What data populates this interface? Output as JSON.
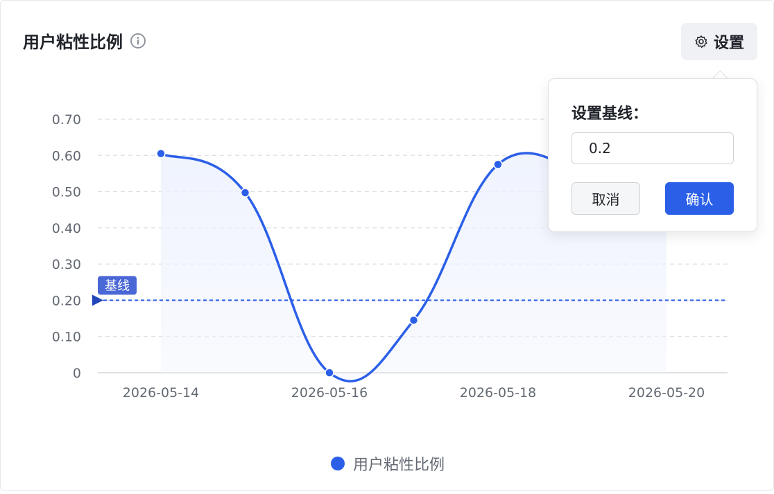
{
  "card": {
    "title": "用户粘性比例",
    "info_icon": "info-circle-icon",
    "settings_label": "设置",
    "settings_icon": "gear-icon"
  },
  "popover": {
    "label": "设置基线：",
    "input_value": "0.2",
    "cancel_label": "取消",
    "confirm_label": "确认"
  },
  "colors": {
    "series": "#2b5fe8",
    "area": "#eef2fd",
    "grid": "#dcdfe3",
    "tick": "#646a73",
    "baseline_tag": "#4a67d6"
  },
  "chart_data": {
    "type": "line",
    "title": "用户粘性比例",
    "x_ticks": [
      "2026-05-14",
      "2026-05-16",
      "2026-05-18",
      "2026-05-20"
    ],
    "y_ticks": [
      "0",
      "0.10",
      "0.20",
      "0.30",
      "0.40",
      "0.50",
      "0.60",
      "0.70"
    ],
    "ylim": [
      0,
      0.7
    ],
    "grid": true,
    "legend_position": "bottom",
    "series": [
      {
        "name": "用户粘性比例",
        "x": [
          "2026-05-14",
          "2026-05-15",
          "2026-05-16",
          "2026-05-17",
          "2026-05-18",
          "2026-05-19"
        ],
        "values": [
          0.605,
          0.497,
          0.0,
          0.145,
          0.575,
          0.55
        ]
      }
    ],
    "baseline": {
      "label": "基线",
      "value": 0.2
    }
  }
}
